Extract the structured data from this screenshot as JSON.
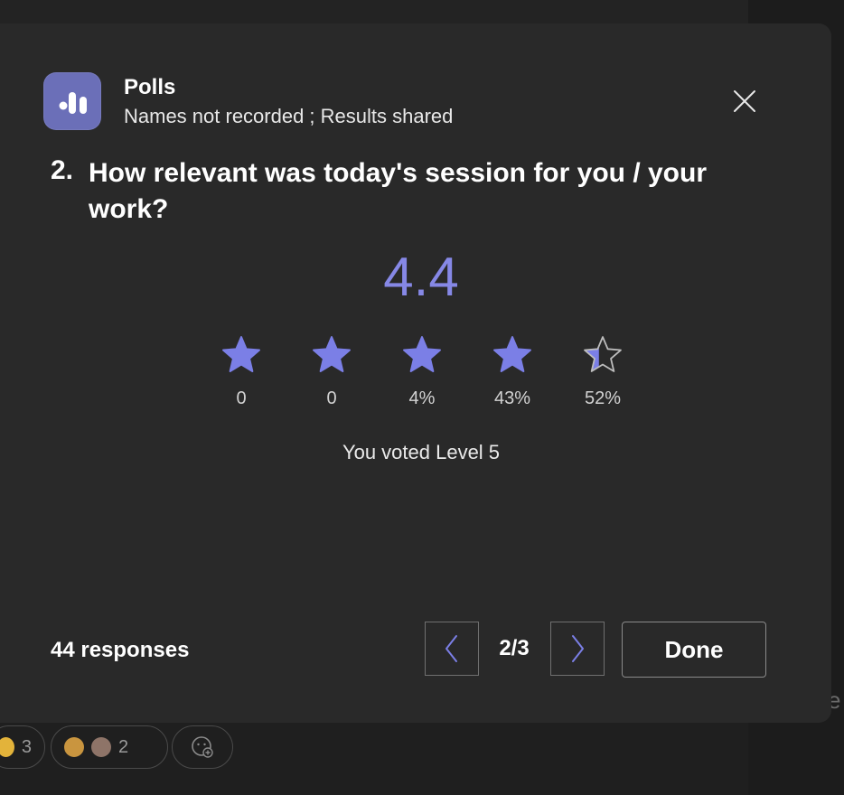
{
  "colors": {
    "accent": "#7b7fe6",
    "card_bg": "#292929",
    "page_bg": "#1f1f1f",
    "icon_tile": "#6b6fb8"
  },
  "header": {
    "app_name": "Polls",
    "subtitle": "Names not recorded ; Results shared",
    "app_icon": "bar-chart-icon",
    "close_icon": "close-icon"
  },
  "question": {
    "number": "2.",
    "text": "How relevant was today's session for you / your work?"
  },
  "result": {
    "average": "4.4",
    "average_value": 4.4,
    "max_rating": 5,
    "distribution": [
      {
        "label": "0",
        "percent": 0
      },
      {
        "label": "0",
        "percent": 0
      },
      {
        "label": "4%",
        "percent": 4
      },
      {
        "label": "43%",
        "percent": 43
      },
      {
        "label": "52%",
        "percent": 52
      }
    ],
    "star_fill": [
      1,
      1,
      1,
      1,
      0.4
    ],
    "voted_text": "You voted Level 5"
  },
  "footer": {
    "responses": "44 responses",
    "page": "2/3",
    "prev_icon": "chevron-left-icon",
    "next_icon": "chevron-right-icon",
    "done_label": "Done"
  },
  "reactions": {
    "first_count": "3",
    "second_count": "2",
    "add_icon": "add-reaction-icon"
  },
  "background": {
    "edge_letter": "e"
  }
}
